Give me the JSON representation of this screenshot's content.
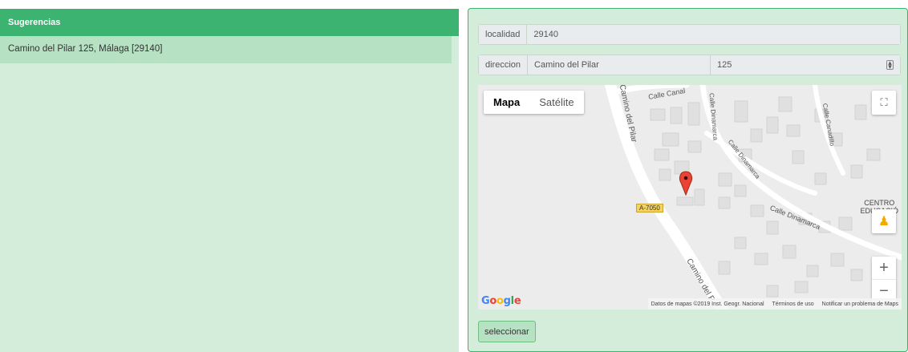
{
  "suggestions": {
    "title": "Sugerencias",
    "items": [
      {
        "label": "Camino del Pilar 125, Málaga [29140]"
      }
    ]
  },
  "form": {
    "localidad": {
      "label": "localidad",
      "value": "29140"
    },
    "direccion": {
      "label": "direccion",
      "street": "Camino del Pilar",
      "number": "125"
    }
  },
  "map": {
    "type_controls": {
      "map": "Mapa",
      "satellite": "Satélite"
    },
    "roads": {
      "calle_canal": "Calle Canal",
      "camino_del_pilar_top": "Camino del Pilar",
      "camino_del_pilar_bottom": "Camino del P",
      "calle_dinamarca_vertical": "Calle Dinamarca",
      "calle_dinamarca_diag": "Calle Dinamarca",
      "calle_dinamarca_lower": "Calle Dinamarca",
      "calle_canadillo": "Calle Canadillo"
    },
    "route_shield": "A-7050",
    "poi": {
      "line1": "CENTRO",
      "line2": "EDUCACIÓ"
    },
    "logo": "Google",
    "attribution": {
      "data": "Datos de mapas ©2019 Inst. Geogr. Nacional",
      "terms": "Términos de uso",
      "report": "Notificar un problema de Maps"
    },
    "zoom_in": "+",
    "zoom_out": "−"
  },
  "actions": {
    "select": "seleccionar"
  },
  "colors": {
    "header_green": "#3cb371",
    "panel_bg": "#d4edda",
    "item_bg": "#b7e1c3",
    "marker_red": "#ea4335"
  }
}
